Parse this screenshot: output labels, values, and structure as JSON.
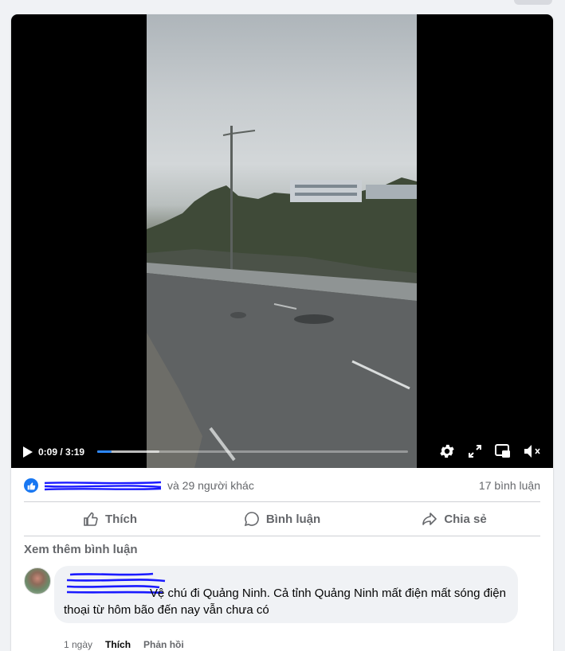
{
  "video": {
    "current_time": "0:09",
    "duration": "3:19",
    "time_separator": " / ",
    "progress_fraction": 0.045,
    "buffered_fraction": 0.2
  },
  "reactions": {
    "others_text": "và 29 người khác",
    "comment_count": "17 bình luận"
  },
  "actions": {
    "like": "Thích",
    "comment": "Bình luận",
    "share": "Chia sẻ"
  },
  "comments_section": {
    "view_more": "Xem thêm bình luận",
    "items": [
      {
        "text": "Vệ chú đi Quảng Ninh. Cả tỉnh Quảng Ninh mất điện mất sóng điện thoại từ hôm bão đến nay vẫn chưa có",
        "time": "1 ngày",
        "like": "Thích",
        "reply": "Phản hồi"
      }
    ]
  },
  "colors": {
    "accent": "#1877f2",
    "progress": "#2d88ff",
    "muted_text": "#65676b"
  }
}
